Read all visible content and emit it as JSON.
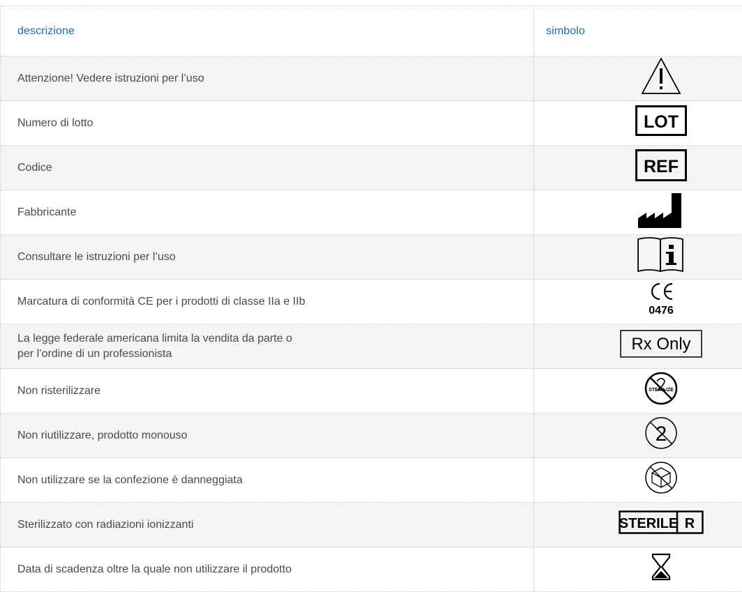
{
  "table": {
    "headers": {
      "description": "descrizione",
      "symbol": "simbolo"
    },
    "rows": [
      {
        "description": "Attenzione! Vedere istruzioni per l’uso",
        "symbol_icon": "warning-triangle-icon"
      },
      {
        "description": "Numero di lotto",
        "symbol_icon": "lot-icon",
        "symbol_text": "LOT"
      },
      {
        "description": "Codice",
        "symbol_icon": "ref-icon",
        "symbol_text": "REF"
      },
      {
        "description": "Fabbricante",
        "symbol_icon": "manufacturer-icon"
      },
      {
        "description": "Consultare le istruzioni per l’uso",
        "symbol_icon": "consult-instructions-icon"
      },
      {
        "description": "Marcatura di conformità CE per i prodotti di classe IIa e IIb",
        "symbol_icon": "ce-mark-icon",
        "symbol_text": "0476"
      },
      {
        "description": "La legge federale americana limita la vendita da parte o per l’ordine di un professionista",
        "description_lines": [
          "La legge federale americana limita la vendita da parte o",
          "per l’ordine di un professionista"
        ],
        "symbol_icon": "rx-only-icon",
        "symbol_text": "Rx Only"
      },
      {
        "description": "Non risterilizzare",
        "symbol_icon": "do-not-resterilize-icon",
        "symbol_text": "STERILIZE"
      },
      {
        "description": "Non riutilizzare, prodotto monouso",
        "symbol_icon": "do-not-reuse-icon",
        "symbol_text": "2"
      },
      {
        "description": "Non utilizzare se la confezione è danneggiata",
        "symbol_icon": "do-not-use-if-damaged-icon"
      },
      {
        "description": "Sterilizzato con radiazioni ionizzanti",
        "symbol_icon": "sterile-r-icon",
        "symbol_text": [
          "STERILE",
          "R"
        ]
      },
      {
        "description": "Data di scadenza oltre la quale non utilizzare il prodotto",
        "symbol_icon": "hourglass-icon"
      }
    ]
  },
  "colors": {
    "header_text": "#1a6fae",
    "body_text": "#4a4a4a",
    "stripe": "#f4f4f4",
    "border": "#c9c9c9"
  }
}
